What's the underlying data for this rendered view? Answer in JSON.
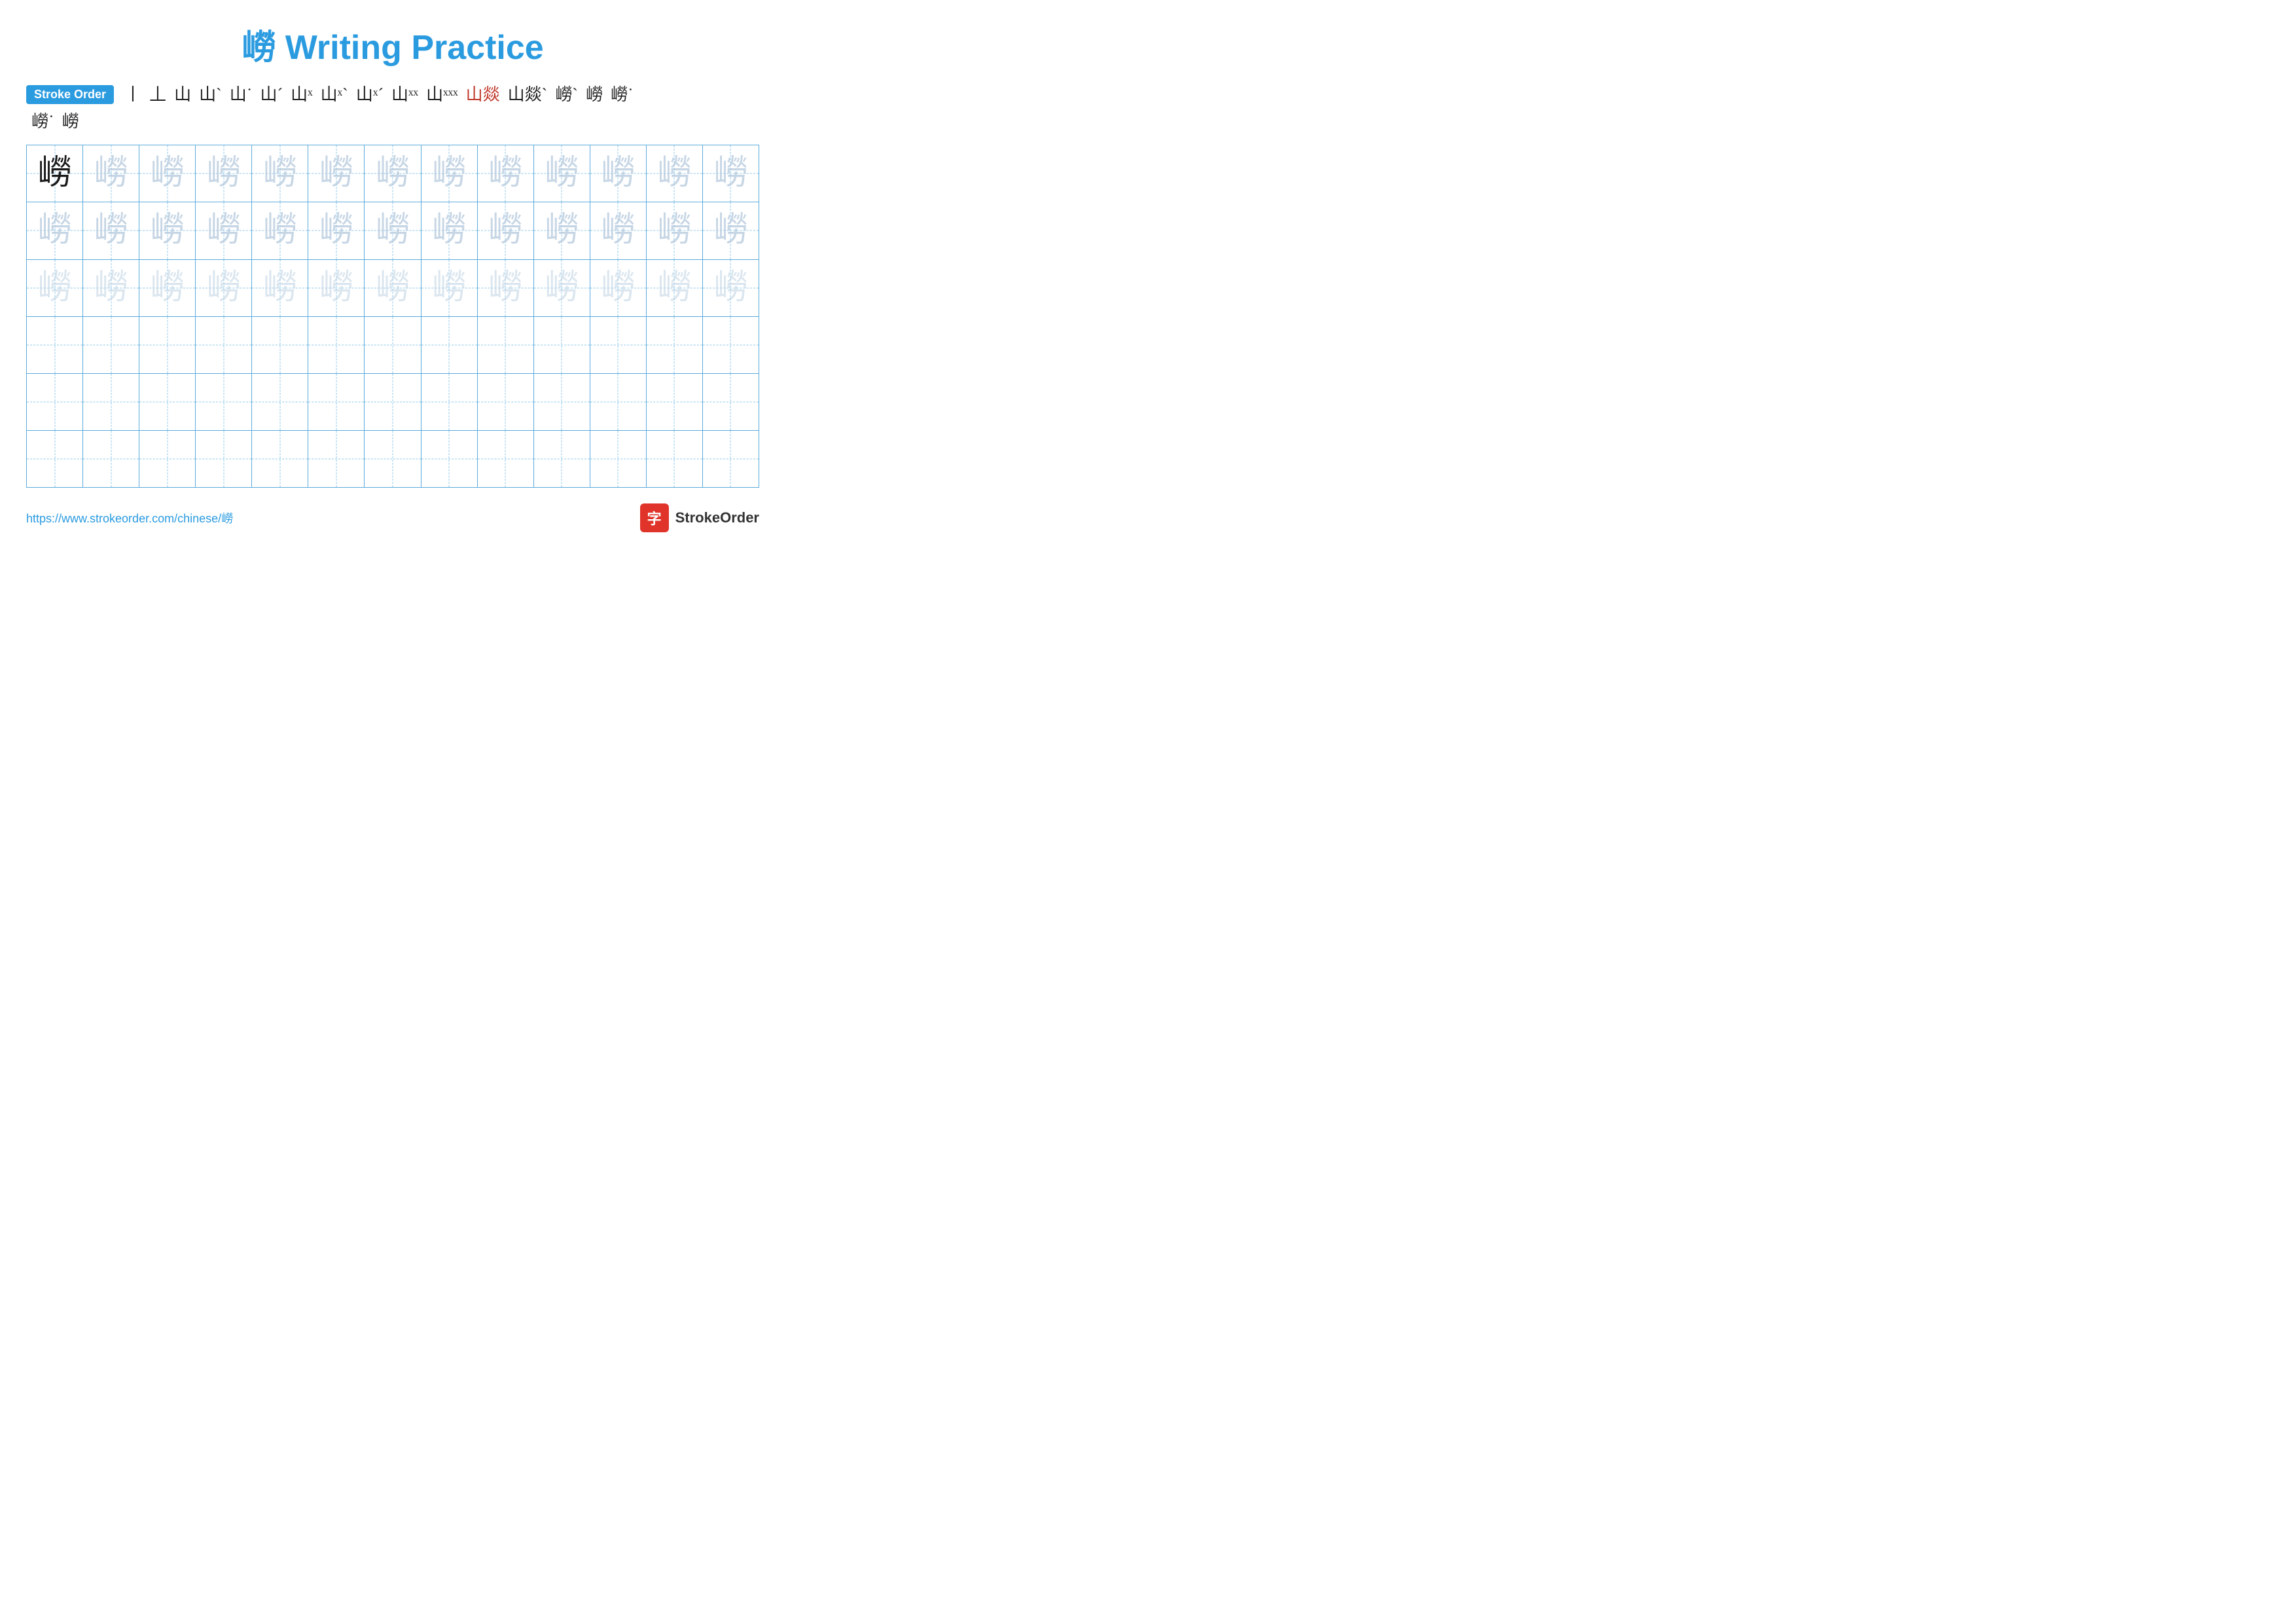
{
  "title": {
    "character": "嶗",
    "label": "Writing Practice",
    "full": "嶗 Writing Practice"
  },
  "stroke_order": {
    "badge_label": "Stroke Order",
    "strokes_row1": [
      "丨",
      "丄",
      "山",
      "山`",
      "山˙",
      "山ˊ",
      "山ˣ",
      "山ˣ`",
      "山ˣˊ",
      "山ˣˣ",
      "山ˣˣˣ",
      "山燚",
      "山燚`",
      "嶗`",
      "嶗",
      "嶗˙"
    ],
    "strokes_row2": [
      "嶗˙",
      "嶗"
    ]
  },
  "grid": {
    "rows": 6,
    "cols": 13,
    "character": "嶗",
    "row1_col1_style": "dark",
    "row1_others_style": "medium-fade",
    "row2_style": "medium-fade",
    "row3_style": "light-fade",
    "row4_style": "very-light",
    "row5_style": "very-light",
    "row6_style": "very-light"
  },
  "footer": {
    "link_text": "https://www.strokeorder.com/chinese/嶗",
    "brand_icon": "字",
    "brand_name": "StrokeOrder"
  }
}
